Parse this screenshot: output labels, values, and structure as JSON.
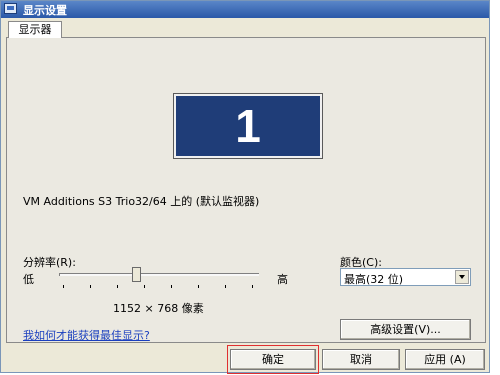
{
  "window": {
    "title": "显示设置"
  },
  "tabs": [
    {
      "label": "显示器"
    }
  ],
  "monitor": {
    "number": "1"
  },
  "device": {
    "label": "VM Additions S3 Trio32/64 上的 (默认监视器)"
  },
  "resolution": {
    "label": "分辨率(R):",
    "low_label": "低",
    "high_label": "高",
    "value": "1152 × 768 像素",
    "level": 0.38
  },
  "color": {
    "label": "颜色(C):",
    "selected": "最高(32 位)"
  },
  "links": {
    "help": "我如何才能获得最佳显示?"
  },
  "buttons": {
    "advanced": "高级设置(V)...",
    "ok": "确定",
    "cancel": "取消",
    "apply": "应用 (A)"
  }
}
